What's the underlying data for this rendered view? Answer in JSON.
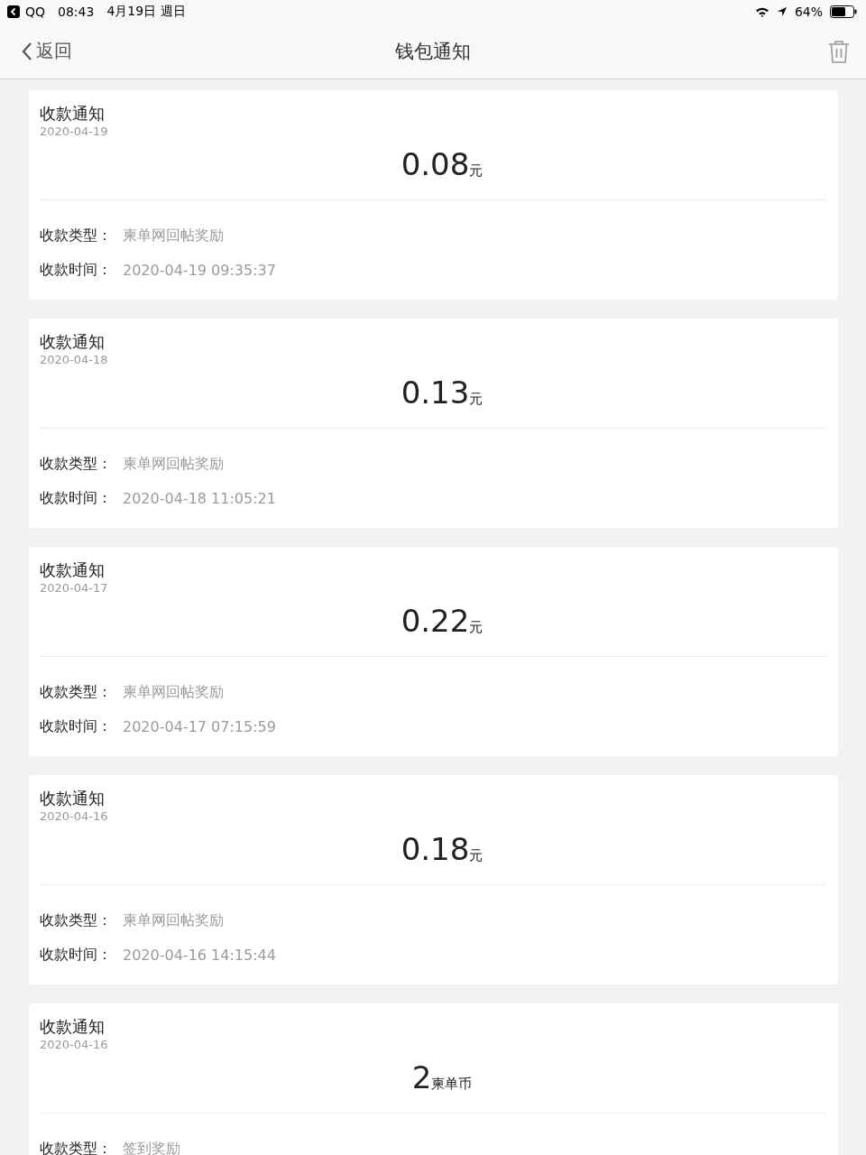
{
  "status_bar": {
    "back_app": "QQ",
    "time": "08:43",
    "date": "4月19日 週日",
    "battery": "64%"
  },
  "nav": {
    "back": "返回",
    "title": "钱包通知"
  },
  "notices": [
    {
      "title": "收款通知",
      "date": "2020-04-19",
      "amount": "0.08",
      "unit": "元",
      "fields": [
        {
          "label": "收款类型：",
          "value": "柬单网回帖奖励"
        },
        {
          "label": "收款时间：",
          "value": "2020-04-19 09:35:37"
        }
      ]
    },
    {
      "title": "收款通知",
      "date": "2020-04-18",
      "amount": "0.13",
      "unit": "元",
      "fields": [
        {
          "label": "收款类型：",
          "value": "柬单网回帖奖励"
        },
        {
          "label": "收款时间：",
          "value": "2020-04-18 11:05:21"
        }
      ]
    },
    {
      "title": "收款通知",
      "date": "2020-04-17",
      "amount": "0.22",
      "unit": "元",
      "fields": [
        {
          "label": "收款类型：",
          "value": "柬单网回帖奖励"
        },
        {
          "label": "收款时间：",
          "value": "2020-04-17 07:15:59"
        }
      ]
    },
    {
      "title": "收款通知",
      "date": "2020-04-16",
      "amount": "0.18",
      "unit": "元",
      "fields": [
        {
          "label": "收款类型：",
          "value": "柬单网回帖奖励"
        },
        {
          "label": "收款时间：",
          "value": "2020-04-16 14:15:44"
        }
      ]
    },
    {
      "title": "收款通知",
      "date": "2020-04-16",
      "amount": "2",
      "unit": "柬单币",
      "fields": [
        {
          "label": "收款类型：",
          "value": "签到奖励"
        }
      ]
    }
  ]
}
